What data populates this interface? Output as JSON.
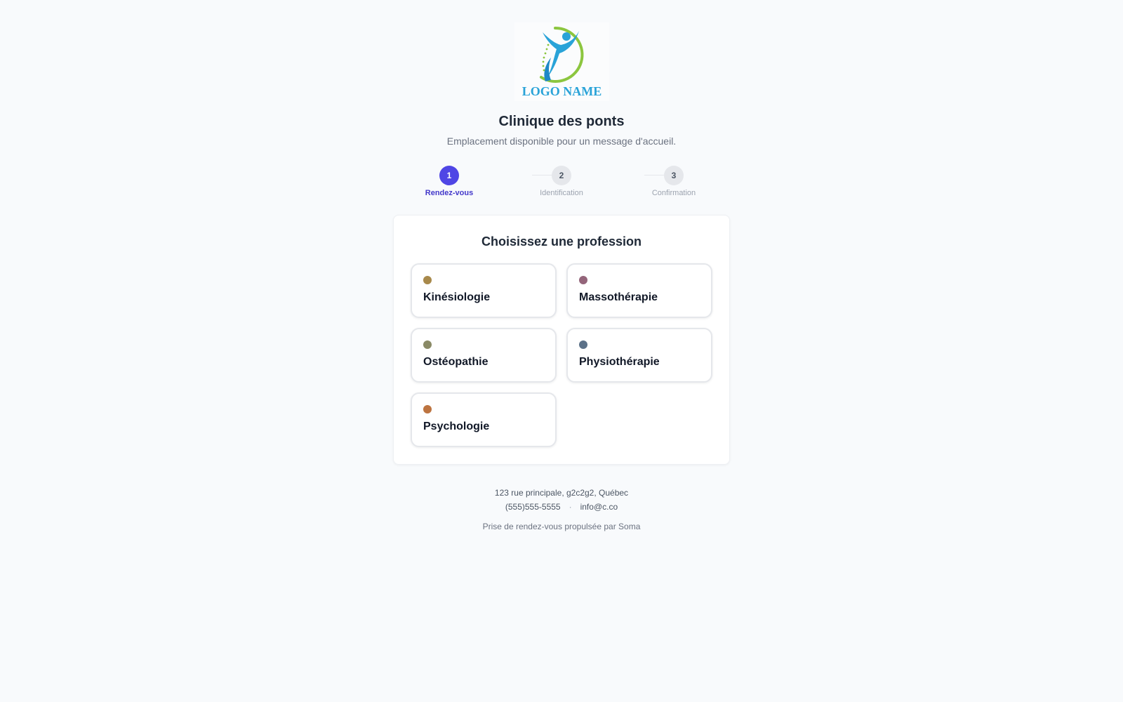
{
  "logo": {
    "text": "LOGO NAME",
    "colors": {
      "primary": "#29a3d8",
      "accent": "#8cc63f"
    }
  },
  "header": {
    "clinic_name": "Clinique des ponts",
    "welcome_message": "Emplacement disponible pour un message d'accueil."
  },
  "stepper": {
    "current_step": 1,
    "accent_color": "#4f46e5",
    "steps": [
      {
        "number": "1",
        "label": "Rendez-vous",
        "state": "active"
      },
      {
        "number": "2",
        "label": "Identification",
        "state": "pending"
      },
      {
        "number": "3",
        "label": "Confirmation",
        "state": "pending"
      }
    ]
  },
  "profession_picker": {
    "title": "Choisissez une profession",
    "options": [
      {
        "label": "Kinésiologie",
        "color": "#a8894b"
      },
      {
        "label": "Massothérapie",
        "color": "#94657a"
      },
      {
        "label": "Ostéopathie",
        "color": "#8a8a66"
      },
      {
        "label": "Physiothérapie",
        "color": "#5c7188"
      },
      {
        "label": "Psychologie",
        "color": "#bd7440"
      }
    ]
  },
  "footer": {
    "address": "123 rue principale, g2c2g2, Québec",
    "phone": "(555)555-5555",
    "separator": "·",
    "email": "info@c.co",
    "powered_by": "Prise de rendez-vous propulsée par Soma"
  }
}
